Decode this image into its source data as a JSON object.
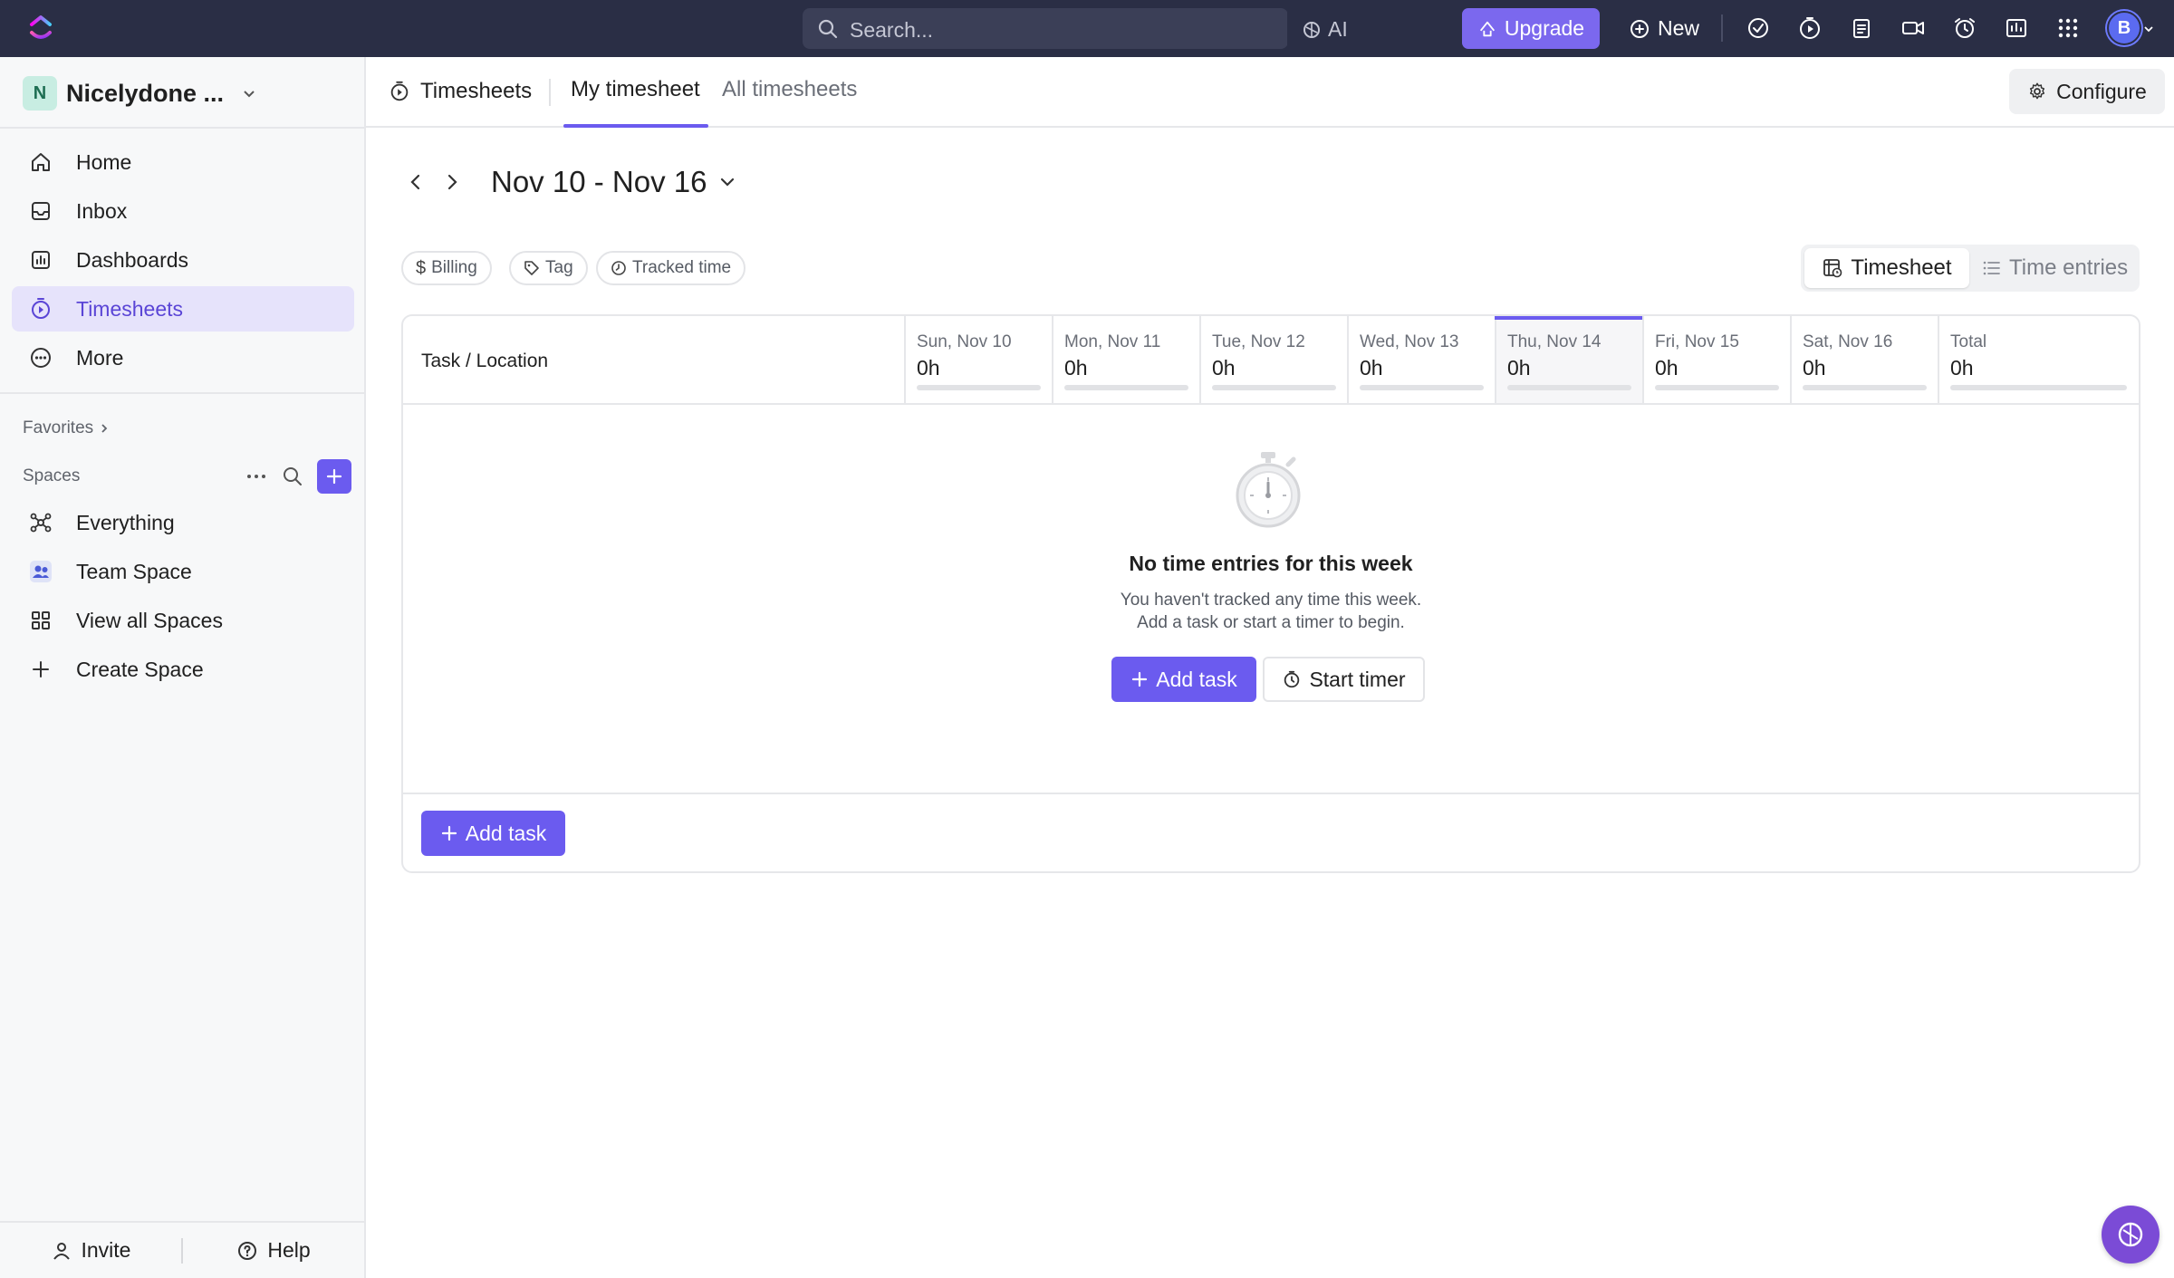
{
  "topbar": {
    "search_placeholder": "Search...",
    "ai_label": "AI",
    "upgrade_label": "Upgrade",
    "new_label": "New",
    "avatar_initial": "B"
  },
  "sidebar": {
    "workspace": {
      "initial": "N",
      "name": "Nicelydone ..."
    },
    "nav": [
      {
        "label": "Home",
        "icon": "home-icon"
      },
      {
        "label": "Inbox",
        "icon": "inbox-icon"
      },
      {
        "label": "Dashboards",
        "icon": "dashboard-icon"
      },
      {
        "label": "Timesheets",
        "icon": "timesheet-icon",
        "active": true
      },
      {
        "label": "More",
        "icon": "more-icon"
      }
    ],
    "favorites_label": "Favorites",
    "spaces_label": "Spaces",
    "spaces": [
      {
        "label": "Everything",
        "icon": "everything-icon"
      },
      {
        "label": "Team Space",
        "icon": "team-icon"
      },
      {
        "label": "View all Spaces",
        "icon": "grid-icon"
      },
      {
        "label": "Create Space",
        "icon": "plus-icon"
      }
    ],
    "invite_label": "Invite",
    "help_label": "Help"
  },
  "header": {
    "title": "Timesheets",
    "tabs": [
      {
        "label": "My timesheet",
        "active": true
      },
      {
        "label": "All timesheets",
        "active": false
      }
    ],
    "configure_label": "Configure"
  },
  "datenav": {
    "range": "Nov 10 - Nov 16"
  },
  "filters": [
    {
      "label": "Billing",
      "icon": "dollar-icon"
    },
    {
      "label": "Tag",
      "icon": "tag-icon"
    },
    {
      "label": "Tracked time",
      "icon": "clock-icon"
    }
  ],
  "view_toggle": {
    "active": "Timesheet",
    "other": "Time entries"
  },
  "table": {
    "task_header": "Task / Location",
    "days": [
      {
        "name": "Sun, Nov 10",
        "value": "0h"
      },
      {
        "name": "Mon, Nov 11",
        "value": "0h"
      },
      {
        "name": "Tue, Nov 12",
        "value": "0h"
      },
      {
        "name": "Wed, Nov 13",
        "value": "0h"
      },
      {
        "name": "Thu, Nov 14",
        "value": "0h",
        "today": true
      },
      {
        "name": "Fri, Nov 15",
        "value": "0h"
      },
      {
        "name": "Sat, Nov 16",
        "value": "0h"
      },
      {
        "name": "Total",
        "value": "0h"
      }
    ],
    "empty": {
      "title": "No time entries for this week",
      "line1": "You haven't tracked any time this week.",
      "line2": "Add a task or start a timer to begin.",
      "add_task_label": "Add task",
      "start_timer_label": "Start timer"
    },
    "footer_add_task_label": "Add task"
  },
  "colors": {
    "accent": "#6b5bef",
    "topbar": "#2a2e45",
    "upgrade": "#7b68ee"
  }
}
